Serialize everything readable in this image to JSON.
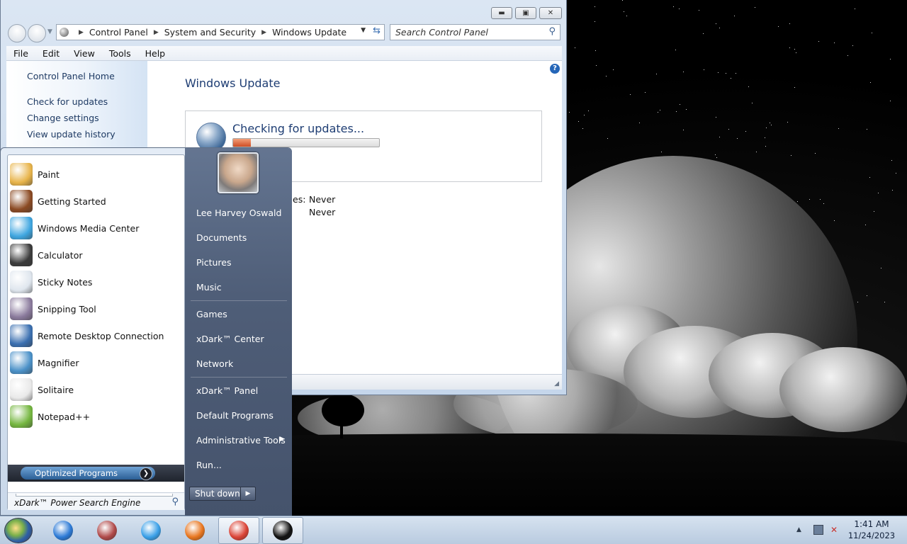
{
  "window": {
    "address_parts": [
      "Control Panel",
      "System and Security",
      "Windows Update"
    ],
    "search_placeholder": "Search Control Panel",
    "menu": [
      "File",
      "Edit",
      "View",
      "Tools",
      "Help"
    ],
    "sidebar_links": [
      "Control Panel Home",
      "Check for updates",
      "Change settings",
      "View update history"
    ],
    "title": "Windows Update",
    "status_text": "Checking for updates...",
    "progress_percent": 12,
    "info_rows": [
      {
        "label_fragment": "es:",
        "value": "Never"
      },
      {
        "label_fragment": "",
        "value": "Never"
      }
    ]
  },
  "start_menu": {
    "programs": [
      {
        "label": "Paint",
        "icon": "paint-icon",
        "color": "#e8b44a"
      },
      {
        "label": "Getting Started",
        "icon": "getting-started-icon",
        "color": "#8b4a23"
      },
      {
        "label": "Windows Media Center",
        "icon": "media-center-icon",
        "color": "#3fa6e0"
      },
      {
        "label": "Calculator",
        "icon": "calculator-icon",
        "color": "#3b3b3b"
      },
      {
        "label": "Sticky Notes",
        "icon": "sticky-notes-icon",
        "color": "#dfe6ee"
      },
      {
        "label": "Snipping Tool",
        "icon": "snipping-tool-icon",
        "color": "#8a7a9c"
      },
      {
        "label": "Remote Desktop Connection",
        "icon": "remote-desktop-icon",
        "color": "#3a6fb0"
      },
      {
        "label": "Magnifier",
        "icon": "magnifier-icon",
        "color": "#4b91c8"
      },
      {
        "label": "Solitaire",
        "icon": "solitaire-icon",
        "color": "#e9e9e9"
      },
      {
        "label": "Notepad++",
        "icon": "notepad-plus-plus-icon",
        "color": "#74b63f"
      }
    ],
    "optimized_label": "Optimized Programs",
    "search_text": "xDark™ Power Search Engine",
    "user_name": "Lee Harvey Oswald",
    "places": [
      "Documents",
      "Pictures",
      "Music",
      "Games",
      "xDark™ Center",
      "Network",
      "xDark™ Panel",
      "Default Programs",
      "Administrative Tools",
      "Run..."
    ],
    "shutdown_label": "Shut down"
  },
  "taskbar": {
    "apps": [
      {
        "name": "internet-explorer-icon",
        "color": "#2c7ad6"
      },
      {
        "name": "archive-app-icon",
        "color": "#b04a4a"
      },
      {
        "name": "itunes-icon",
        "color": "#3aa0e8"
      },
      {
        "name": "firefox-icon",
        "color": "#e8761f"
      },
      {
        "name": "chrome-icon",
        "color": "#db4437"
      },
      {
        "name": "xdark-app-icon",
        "color": "#111111"
      }
    ],
    "time": "1:41 AM",
    "date": "11/24/2023"
  }
}
